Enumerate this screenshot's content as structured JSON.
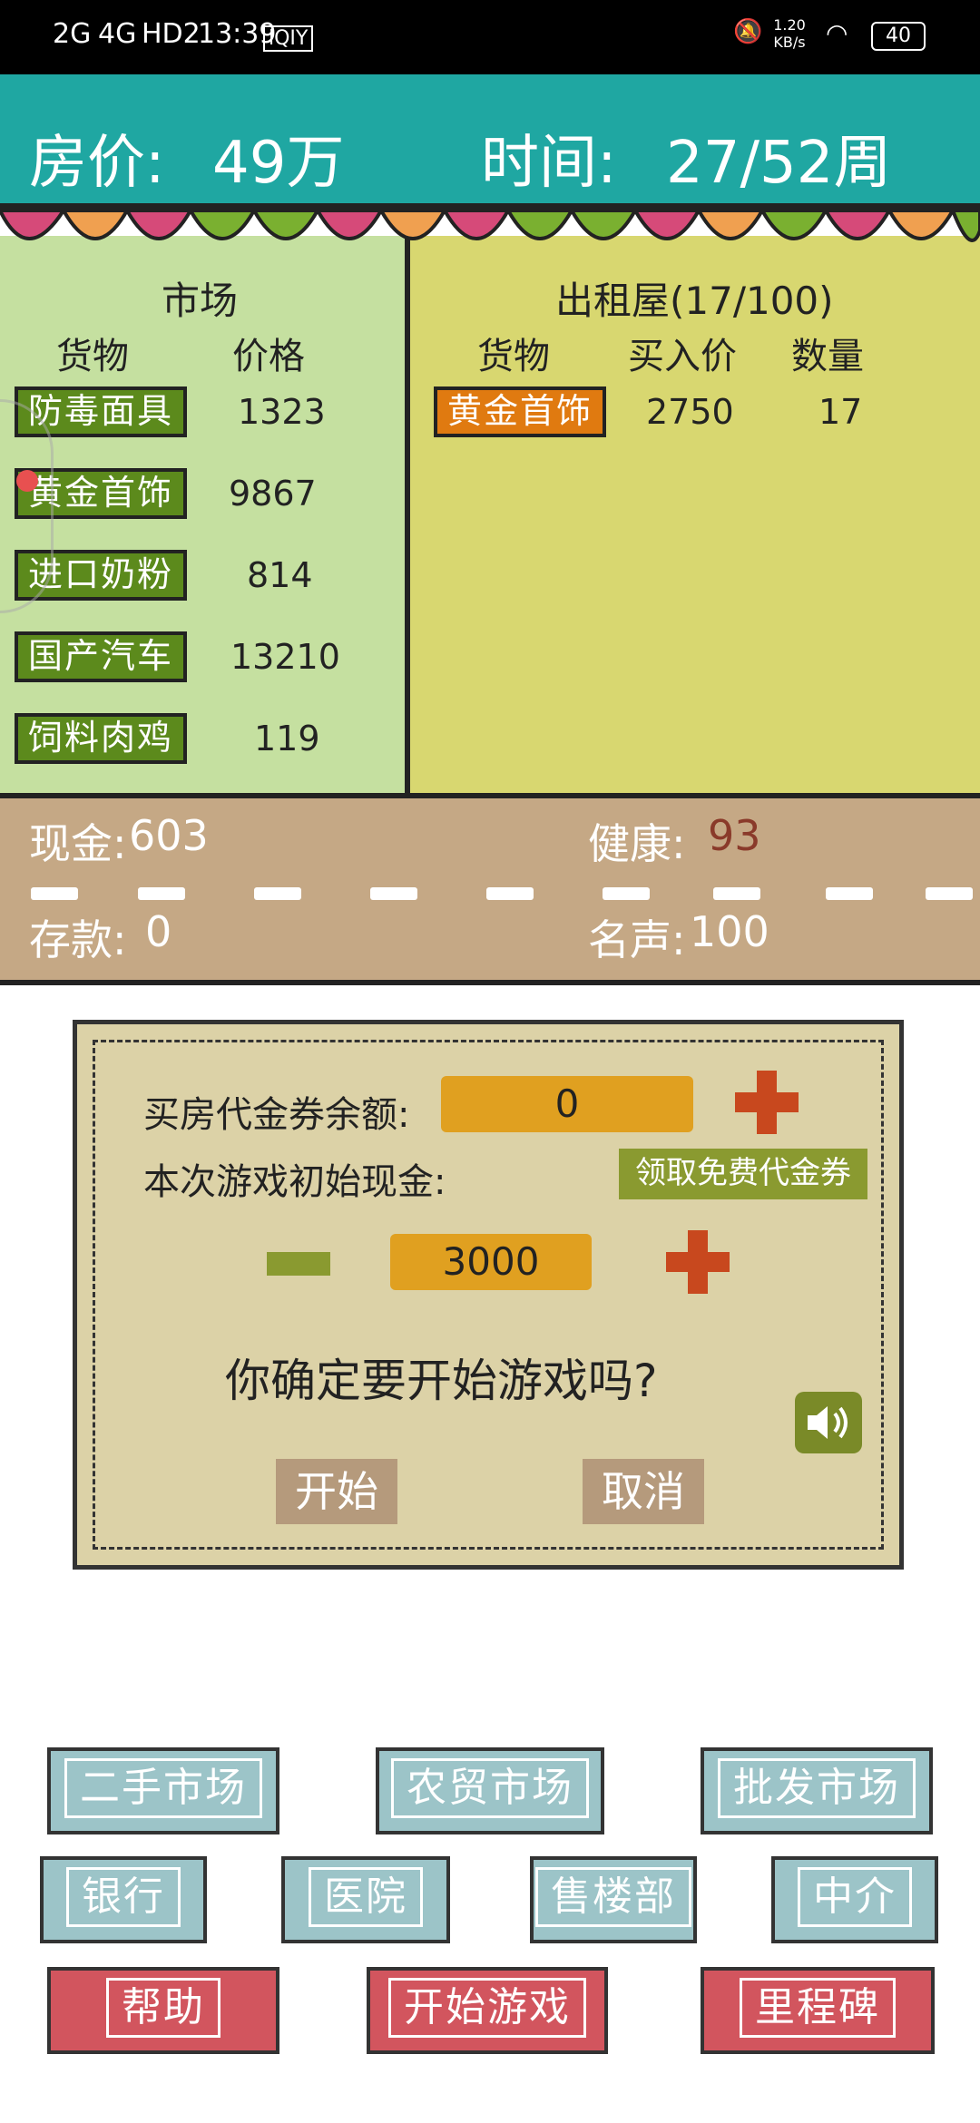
{
  "status_bar": {
    "network_left": "2G",
    "network_mid": "4G",
    "hd": "HD2",
    "time": "13:39",
    "speed": "1.20 KB/s",
    "battery": "40"
  },
  "header": {
    "price_label": "房价:",
    "price_value": "49万",
    "time_label": "时间:",
    "time_value": "27/52周"
  },
  "market": {
    "title": "市场",
    "col_goods": "货物",
    "col_price": "价格",
    "items": [
      {
        "name": "防毒面具",
        "price": "1323"
      },
      {
        "name": "黄金首饰",
        "price": "9867"
      },
      {
        "name": "进口奶粉",
        "price": "814"
      },
      {
        "name": "国产汽车",
        "price": "13210"
      },
      {
        "name": "饲料肉鸡",
        "price": "119"
      }
    ]
  },
  "rental": {
    "title": "出租屋(17/100)",
    "col_goods": "货物",
    "col_buy": "买入价",
    "col_qty": "数量",
    "items": [
      {
        "name": "黄金首饰",
        "buy": "2750",
        "qty": "17"
      }
    ]
  },
  "stats": {
    "cash_label": "现金:",
    "cash": "603",
    "health_label": "健康:",
    "health": "93",
    "deposit_label": "存款:",
    "deposit": "0",
    "fame_label": "名声:",
    "fame": "100"
  },
  "dialog": {
    "voucher_label": "买房代金券余额:",
    "voucher_value": "0",
    "initial_label": "本次游戏初始现金:",
    "free_voucher_btn": "领取免费代金券",
    "initial_cash": "3000",
    "question": "你确定要开始游戏吗?",
    "start_btn": "开始",
    "cancel_btn": "取消"
  },
  "nav": {
    "row1": [
      "二手市场",
      "农贸市场",
      "批发市场"
    ],
    "row2": [
      "银行",
      "医院",
      "售楼部",
      "中介"
    ],
    "row3": [
      "帮助",
      "开始游戏",
      "里程碑"
    ]
  },
  "colors": {
    "header": "#1fa7a2",
    "market_left": "#c5e0a0",
    "market_right": "#d8d770",
    "green_button": "#5c8a1c",
    "orange_button": "#e07a10",
    "stats_band": "#c5a885",
    "dialog_bg": "#dcd2a7",
    "nav_blue": "#9cc4c8",
    "nav_red": "#d2555e"
  }
}
